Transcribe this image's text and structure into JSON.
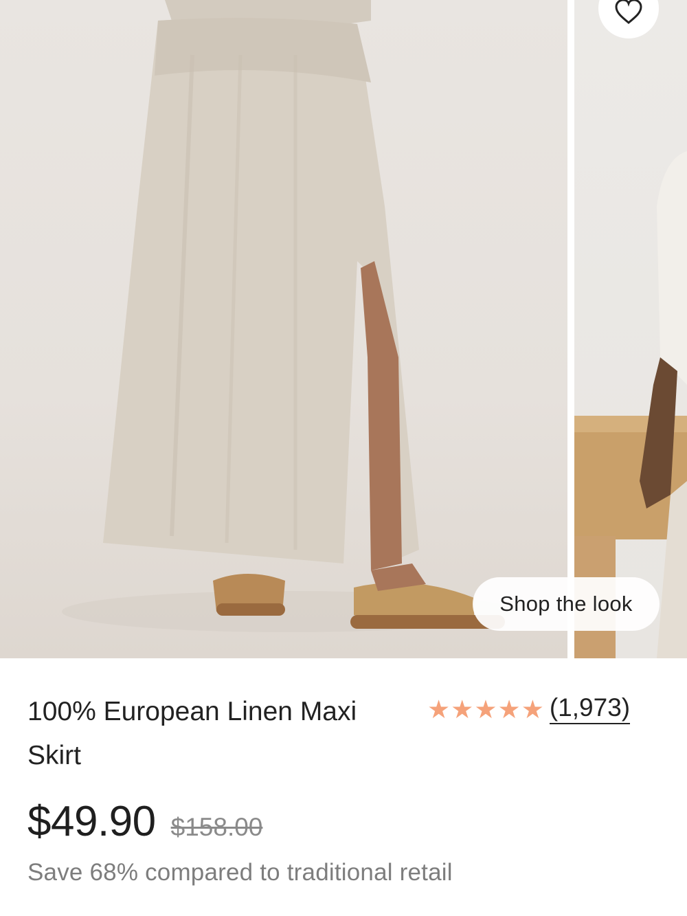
{
  "gallery": {
    "shop_look_label": "Shop the look",
    "favorite_icon": "heart-icon"
  },
  "product": {
    "title": "100% European Linen Maxi Skirt",
    "rating": {
      "stars": 5,
      "star_color": "#f5a27a",
      "count_label": "(1,973)"
    },
    "price": "$49.90",
    "original_price": "$158.00",
    "savings_text": "Save 68% compared to traditional retail"
  }
}
